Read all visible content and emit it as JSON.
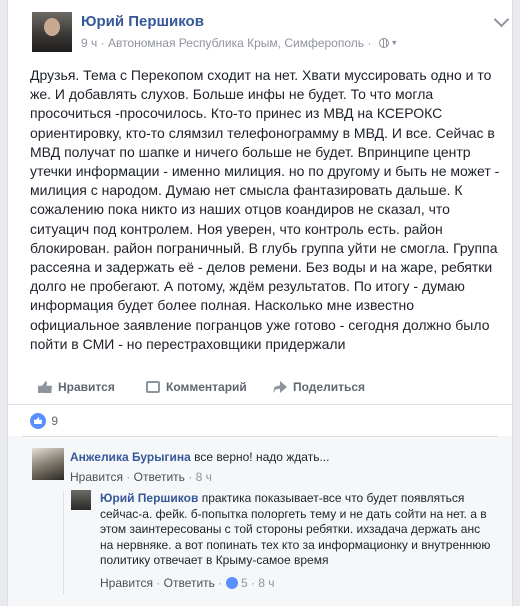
{
  "post": {
    "author": "Юрий Першиков",
    "time": "9 ч",
    "location": "Автономная Республика Крым, Симферополь",
    "separator": "·",
    "text": "Друзья. Тема с Перекопом сходит на нет. Хвати муссировать одно и то же. И добавлять слухов. Больше инфы не будет. То что могла просочиться -просочилось. Кто-то принес из МВД на КСЕРОКС ориентировку, кто-то слямзил телефонограмму в МВД. И все. Сейчас в МВД получат по шапке и ничего больше не будет. Впринципе центр утечки информации - именно милиция. но по другому и быть не может - милиция с народом. Думаю нет смысла фантазировать дальше. К сожалению пока никто из наших отцов коандиров не сказал, что ситуацич под контролем. Ноя уверен, что контроль есть. район блокирован. район пограничный. В глубь группа уйти не смогла. Группа рассеяна и задержать её - делов ремени. Без воды и на жаре, ребятки долго не пробегают. А потому, ждём результатов. По итогу - думаю информация будет более полная. Насколько мне известно официальное заявление погранцов уже готово - сегодня должно было пойти в СМИ - но перестраховщики придержали"
  },
  "actions": {
    "like": "Нравится",
    "comment": "Комментарий",
    "share": "Поделиться"
  },
  "likes_count": "9",
  "comments": [
    {
      "author": "Анжелика Бурыгина",
      "text": "все верно! надо ждать...",
      "like": "Нравится",
      "reply": "Ответить",
      "time": "8 ч"
    },
    {
      "author": "Юрий Першиков",
      "text": "практика показывает-все что будет появляться сейчас-а. фейк. б-попытка полоргеть тему и не дать сойти на нет. а в этом заинтересованы с той стороны ребятки. ихзадача держать анс на нервняке. а вот попинать тех кто за информационку и внутреннюю политику отвечает в Крыму-самое время",
      "like": "Нравится",
      "reply": "Ответить",
      "likes": "5",
      "time": "8 ч"
    }
  ]
}
